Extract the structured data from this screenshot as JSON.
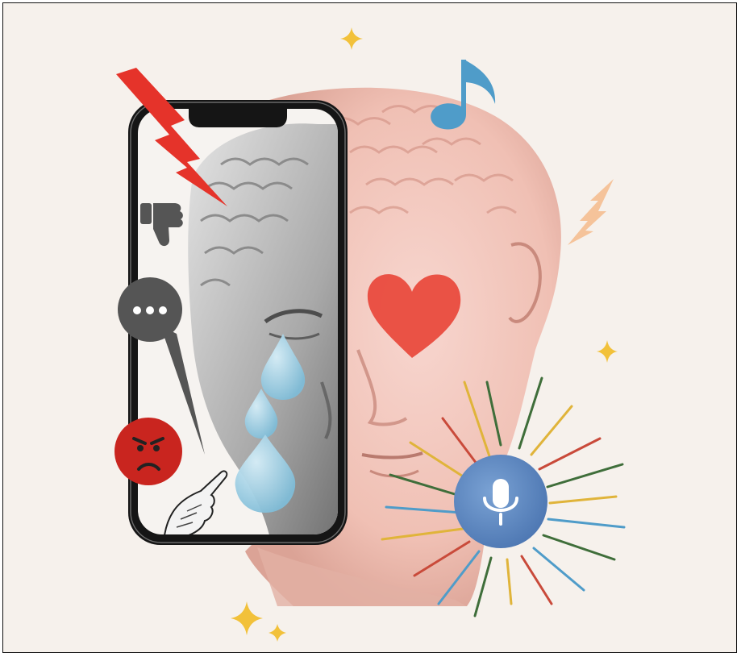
{
  "illustration": {
    "palette": {
      "background": "#f6f1ec",
      "statue_pink": "#f2c7bd",
      "statue_shadow": "#d99f93",
      "heart": "#e8473a",
      "mic_circle": "#5b87c2",
      "phone_bezel": "#151515",
      "tear": "#9fd0e6",
      "lightning_red": "#e5332a",
      "lightning_peach": "#f5c39a",
      "sparkle": "#f2c13a",
      "music_note": "#4f9cc9",
      "speech_bubble": "#555555",
      "angry_face": "#c9251f"
    },
    "icons": {
      "thumbs_down": "thumbs-down-icon",
      "speech_bubble": "speech-bubble-icon",
      "microphone": "microphone-icon",
      "heart": "heart-icon",
      "music_note": "music-note-icon"
    }
  }
}
